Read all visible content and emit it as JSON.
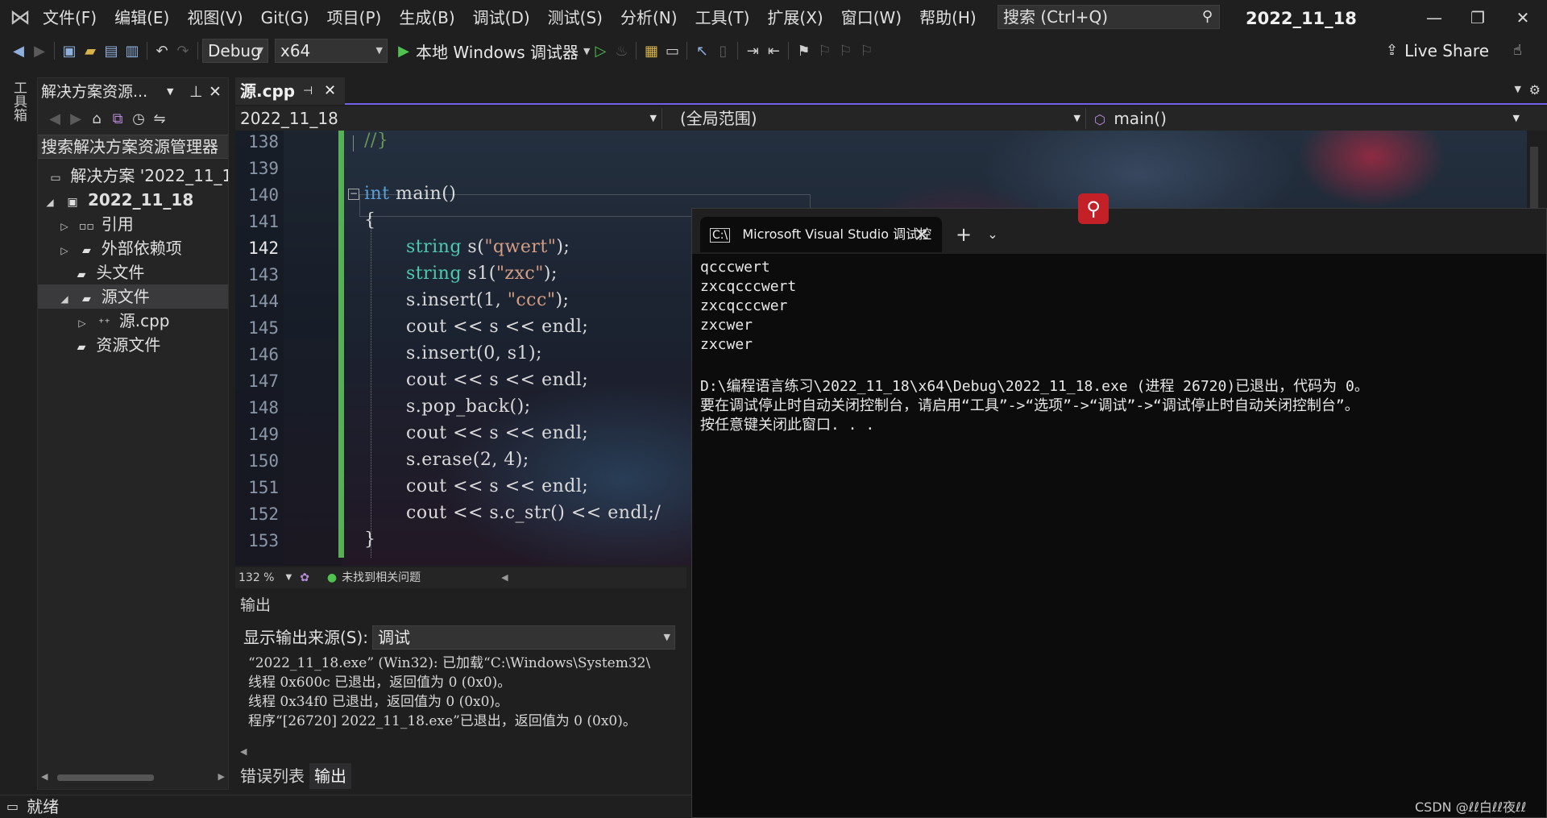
{
  "menubar": {
    "items": [
      "文件(F)",
      "编辑(E)",
      "视图(V)",
      "Git(G)",
      "项目(P)",
      "生成(B)",
      "调试(D)",
      "测试(S)",
      "分析(N)",
      "工具(T)",
      "扩展(X)",
      "窗口(W)",
      "帮助(H)"
    ],
    "search_label": "搜索 (Ctrl+Q)",
    "window_title": "2022_11_18"
  },
  "toolbar": {
    "config": "Debug",
    "platform": "x64",
    "run_label": "本地 Windows 调试器",
    "live_share": "Live Share"
  },
  "tool_strip": {
    "label": "工具箱"
  },
  "solution": {
    "header": "解决方案资源...",
    "search": "搜索解决方案资源管理器",
    "items": [
      {
        "label": "解决方案 '2022_11_18'",
        "icon": "solution-icon",
        "expander": ""
      },
      {
        "label": "2022_11_18",
        "icon": "project-icon",
        "expander": "◢"
      },
      {
        "label": "引用",
        "icon": "reference-icon",
        "expander": "▷"
      },
      {
        "label": "外部依赖项",
        "icon": "folder-icon",
        "expander": "▷"
      },
      {
        "label": "头文件",
        "icon": "folder-icon",
        "expander": ""
      },
      {
        "label": "源文件",
        "icon": "folder-icon",
        "expander": "◢"
      },
      {
        "label": "源.cpp",
        "icon": "cpp-file-icon",
        "expander": "▷"
      },
      {
        "label": "资源文件",
        "icon": "folder-icon",
        "expander": ""
      }
    ]
  },
  "editor": {
    "tab_name": "源.cpp",
    "nav_project": "2022_11_18",
    "nav_scope": "(全局范围)",
    "nav_member": "main()",
    "zoom": "132 %",
    "issues": "未找到相关问题",
    "line_numbers": [
      "138",
      "139",
      "140",
      "141",
      "142",
      "143",
      "144",
      "145",
      "146",
      "147",
      "148",
      "149",
      "150",
      "151",
      "152",
      "153"
    ],
    "current_line": "142",
    "code": {
      "l138": "//}",
      "l140_kw": "int",
      "l140_rest": " main()",
      "l141": "{",
      "l142_ty": "string",
      "l142_a": " s(",
      "l142_str": "\"qwert\"",
      "l142_b": ");",
      "l143_ty": "string",
      "l143_a": " s1(",
      "l143_str": "\"zxc\"",
      "l143_b": ");",
      "l144_a": "s.insert(1, ",
      "l144_str": "\"ccc\"",
      "l144_b": ");",
      "l145": "cout << s << endl;",
      "l146": "s.insert(0, s1);",
      "l147": "cout << s << endl;",
      "l148": "s.pop_back();",
      "l149": "cout << s << endl;",
      "l150": "s.erase(2, 4);",
      "l151": "cout << s << endl;",
      "l152": "cout << s.c_str() << endl;/",
      "l153": "}"
    }
  },
  "output": {
    "title": "输出",
    "source_label": "显示输出来源(S):",
    "source_value": "调试",
    "lines": [
      "“2022_11_18.exe” (Win32): 已加载“C:\\Windows\\System32\\",
      "线程 0x600c 已退出，返回值为 0 (0x0)。",
      "线程 0x34f0 已退出，返回值为 0 (0x0)。",
      "程序“[26720] 2022_11_18.exe”已退出，返回值为 0 (0x0)。"
    ]
  },
  "bottom_tabs": [
    "错误列表",
    "输出"
  ],
  "status": {
    "text": "就绪"
  },
  "console": {
    "tab_title": "Microsoft Visual Studio 调试控",
    "lines": [
      "qcccwert",
      "zxcqcccwert",
      "zxcqcccwer",
      "zxcwer",
      "zxcwer",
      "",
      "D:\\编程语言练习\\2022_11_18\\x64\\Debug\\2022_11_18.exe (进程 26720)已退出，代码为 0。",
      "要在调试停止时自动关闭控制台，请启用“工具”->“选项”->“调试”->“调试停止时自动关闭控制台”。",
      "按任意键关闭此窗口. . ."
    ]
  },
  "watermark": "CSDN @ℓℓ白ℓℓ夜ℓℓ"
}
